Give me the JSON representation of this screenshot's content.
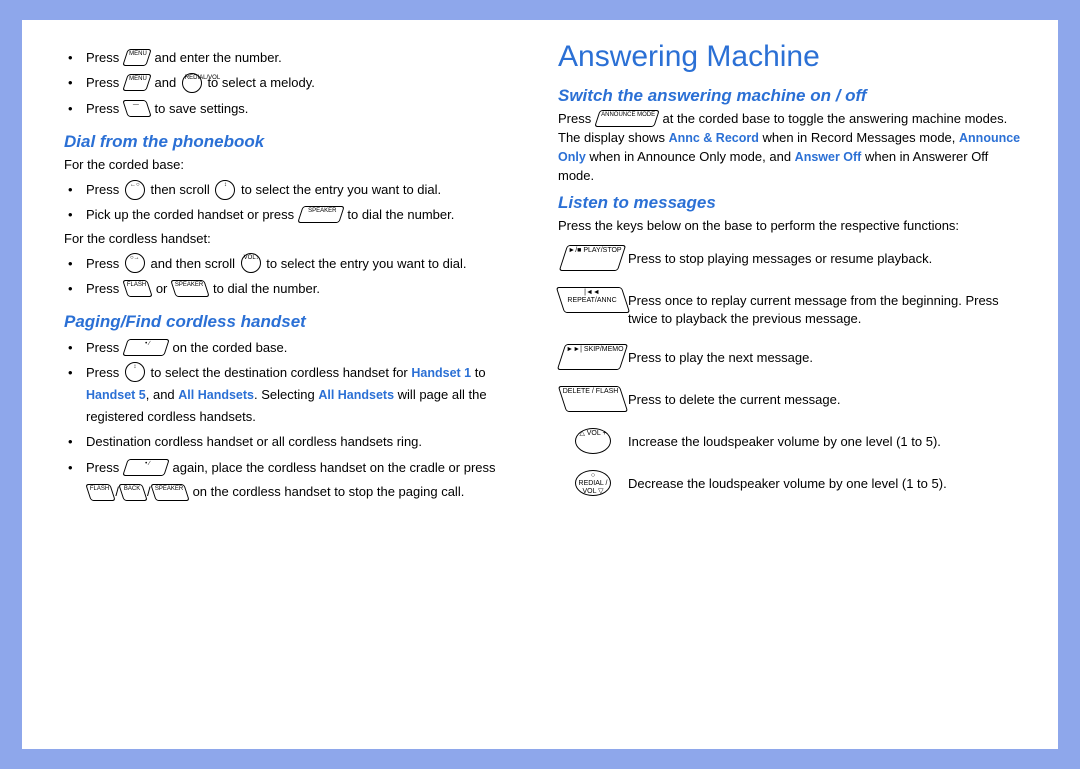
{
  "left": {
    "top_bullets": [
      {
        "pre": "Press",
        "key": "MENU",
        "post": "and enter the number."
      },
      {
        "pre": "Press",
        "key": "MENU",
        "mid": "and",
        "key2": "REDIAL/VOL",
        "post": "to select a melody."
      },
      {
        "pre": "Press",
        "key": "—",
        "post": "to save settings."
      }
    ],
    "dial_heading": "Dial from the phonebook",
    "dial_corded_intro": "For the corded base:",
    "dial_corded": [
      {
        "pre": "Press",
        "key": "←○",
        "mid": "then scroll",
        "key2": "↕",
        "post": "to select the entry you want to dial."
      },
      {
        "pre": "Pick up the corded handset or press",
        "key": "SPEAKER",
        "post": "to dial the number."
      }
    ],
    "dial_cordless_intro": "For the cordless handset:",
    "dial_cordless": [
      {
        "pre": "Press",
        "key": "○→",
        "mid": "and then scroll",
        "key2": "VOL↕",
        "post": "to select the entry you want to dial."
      },
      {
        "pre": "Press",
        "key": "FLASH",
        "mid": "or",
        "key2": "SPEAKER",
        "post": "to dial the number."
      }
    ],
    "paging_heading": "Paging/Find cordless handset",
    "paging": {
      "b1": {
        "pre": "Press",
        "key": "• ∕",
        "post": "on the corded base."
      },
      "b2": {
        "pre": "Press",
        "key": "↕",
        "post_a": "to select the destination cordless handset for ",
        "kw1": "Handset 1",
        "post_b": " to ",
        "kw2": "Handset 5",
        "post_c": ", and ",
        "kw3": "All Handsets",
        "post_d": ". Selecting ",
        "kw4": "All Handsets",
        "post_e": " will page all the registered cordless handsets."
      },
      "b3": "Destination cordless handset or all cordless handsets ring.",
      "b4": {
        "pre": "Press",
        "key": "• ∕",
        "mid": "again, place the cordless handset on the cradle or press",
        "k1": "FLASH",
        "sep1": "/",
        "k2": "BACK",
        "sep2": "/",
        "k3": "SPEAKER",
        "post": "on the cordless handset to stop the paging call."
      }
    }
  },
  "right": {
    "title": "Answering Machine",
    "switch_heading": "Switch the answering machine on / off",
    "switch_text_a": "Press",
    "switch_key": "ANNOUNCE MODE",
    "switch_text_b": "at the corded base to toggle the answering machine modes. The display shows ",
    "kw_annc": "Annc & Record",
    "switch_text_c": " when in Record Messages mode, ",
    "kw_ao": "Announce Only",
    "switch_text_d": " when in Announce Only mode, and ",
    "kw_off": "Answer Off",
    "switch_text_e": " when in Answerer Off mode.",
    "listen_heading": "Listen to messages",
    "listen_intro": "Press the keys below on the base to perform the respective functions:",
    "functions": [
      {
        "key": "►/■ PLAY/STOP",
        "desc": "Press to stop playing messages or resume playback."
      },
      {
        "key": "|◄◄ REPEAT/ANNC",
        "desc": "Press once to replay current message from the beginning. Press twice to playback the previous message."
      },
      {
        "key": "►►| SKIP/MEMO",
        "desc": "Press to play the next message."
      },
      {
        "key": "DELETE / FLASH",
        "desc": "Press to delete the current message."
      },
      {
        "key": "△ VOL +",
        "desc": "Increase the loudspeaker volume by one level (1 to 5)."
      },
      {
        "key": "○ REDIAL / VOL ▽",
        "desc": "Decrease the loudspeaker volume by one level (1 to 5)."
      }
    ]
  }
}
